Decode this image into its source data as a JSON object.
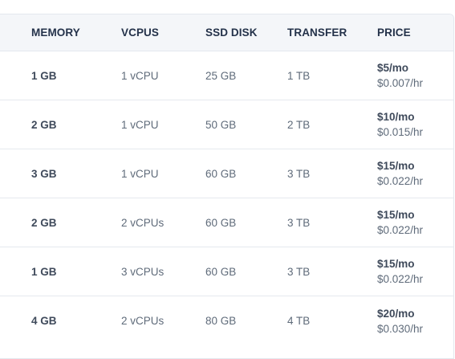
{
  "headers": {
    "memory": "MEMORY",
    "vcpus": "VCPUS",
    "ssd_disk": "SSD DISK",
    "transfer": "TRANSFER",
    "price": "PRICE"
  },
  "rows": [
    {
      "memory": "1 GB",
      "vcpus": "1 vCPU",
      "ssd": "25 GB",
      "transfer": "1 TB",
      "price_monthly": "$5/mo",
      "price_hourly": "$0.007/hr"
    },
    {
      "memory": "2 GB",
      "vcpus": "1 vCPU",
      "ssd": "50 GB",
      "transfer": "2 TB",
      "price_monthly": "$10/mo",
      "price_hourly": "$0.015/hr"
    },
    {
      "memory": "3 GB",
      "vcpus": "1 vCPU",
      "ssd": "60 GB",
      "transfer": "3 TB",
      "price_monthly": "$15/mo",
      "price_hourly": "$0.022/hr"
    },
    {
      "memory": "2 GB",
      "vcpus": "2 vCPUs",
      "ssd": "60 GB",
      "transfer": "3 TB",
      "price_monthly": "$15/mo",
      "price_hourly": "$0.022/hr"
    },
    {
      "memory": "1 GB",
      "vcpus": "3 vCPUs",
      "ssd": "60 GB",
      "transfer": "3 TB",
      "price_monthly": "$15/mo",
      "price_hourly": "$0.022/hr"
    },
    {
      "memory": "4 GB",
      "vcpus": "2 vCPUs",
      "ssd": "80 GB",
      "transfer": "4 TB",
      "price_monthly": "$20/mo",
      "price_hourly": "$0.030/hr"
    }
  ]
}
